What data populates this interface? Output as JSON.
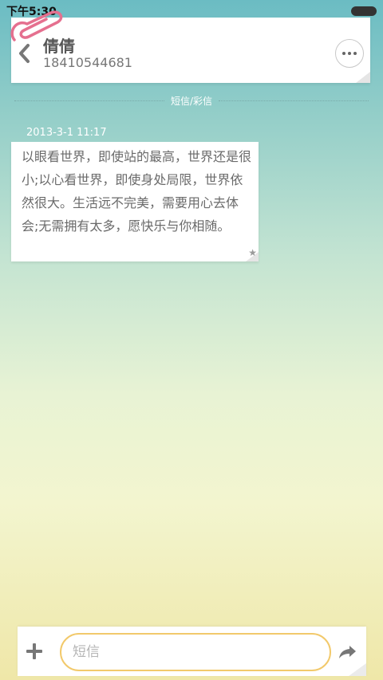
{
  "status_bar": {
    "time": "下午5:30"
  },
  "header": {
    "contact_name": "倩倩",
    "contact_number": "18410544681",
    "back_icon": "chevron-left-icon",
    "more_icon": "more-dots-icon"
  },
  "divider": {
    "label": "短信/彩信"
  },
  "messages": [
    {
      "timestamp": "2013-3-1 11:17",
      "text": "以眼看世界，即使站的最高，世界还是很小;以心看世界，即使身处局限，世界依然很大。生活远不完美，需要用心去体会;无需拥有太多，愿快乐与你相随。"
    }
  ],
  "input_bar": {
    "placeholder": "短信",
    "value": "",
    "add_icon": "plus-icon",
    "send_icon": "share-arrow-icon"
  },
  "colors": {
    "input_border": "#f2c96b",
    "paperclip": "#e5708f",
    "bg_top": "#6bbcc3",
    "bg_bottom": "#efe7a8"
  }
}
